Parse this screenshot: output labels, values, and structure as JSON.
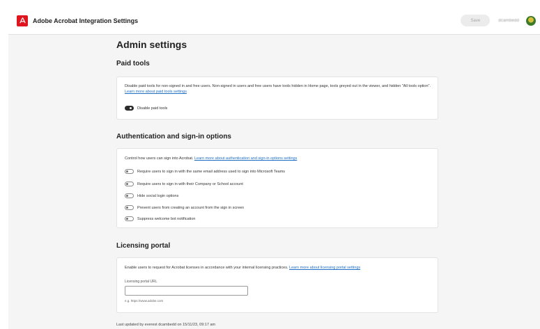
{
  "header": {
    "title": "Adobe Acrobat Integration Settings",
    "save_label": "Save",
    "username": "dcambedd"
  },
  "page": {
    "title": "Admin settings"
  },
  "paid_tools": {
    "section_title": "Paid tools",
    "description": "Disable paid tools for non-signed in and free users. Non-signed in users and free users have tools hidden in Home page, tools greyed out in the viewer, and hidden \"All tools option\".",
    "link": "Learn more about paid tools settings",
    "toggle": {
      "label": "Disable paid tools",
      "on": true
    }
  },
  "auth": {
    "section_title": "Authentication and sign-in options",
    "description": "Control how users can sign into Acrobat.",
    "link": "Learn more about authentication and sign-in options settings",
    "options": [
      {
        "label": "Require users to sign in with the same email address used to sign into Microsoft Teams",
        "on": false
      },
      {
        "label": "Require users to sign in with their Company or School account",
        "on": false
      },
      {
        "label": "Hide social login options",
        "on": false
      },
      {
        "label": "Prevent users from creating an account from the sign in screen",
        "on": false
      },
      {
        "label": "Suppress welcome bot notification",
        "on": false
      }
    ]
  },
  "licensing": {
    "section_title": "Licensing portal",
    "description": "Enable users to request for Acrobat licenses in accordance with your internal licensing practices.",
    "link": "Learn more about licensing portal settings",
    "field_label": "Licensing portal URL",
    "field_value": "",
    "hint": "e.g. https://www.adobe.com"
  },
  "footer": {
    "last_updated": "Last updated by everest dcambedd on 15/11/23, 09:17 am"
  },
  "colors": {
    "brand": "#e0141e",
    "link": "#1f6fc4",
    "background": "#f5f5f5"
  }
}
